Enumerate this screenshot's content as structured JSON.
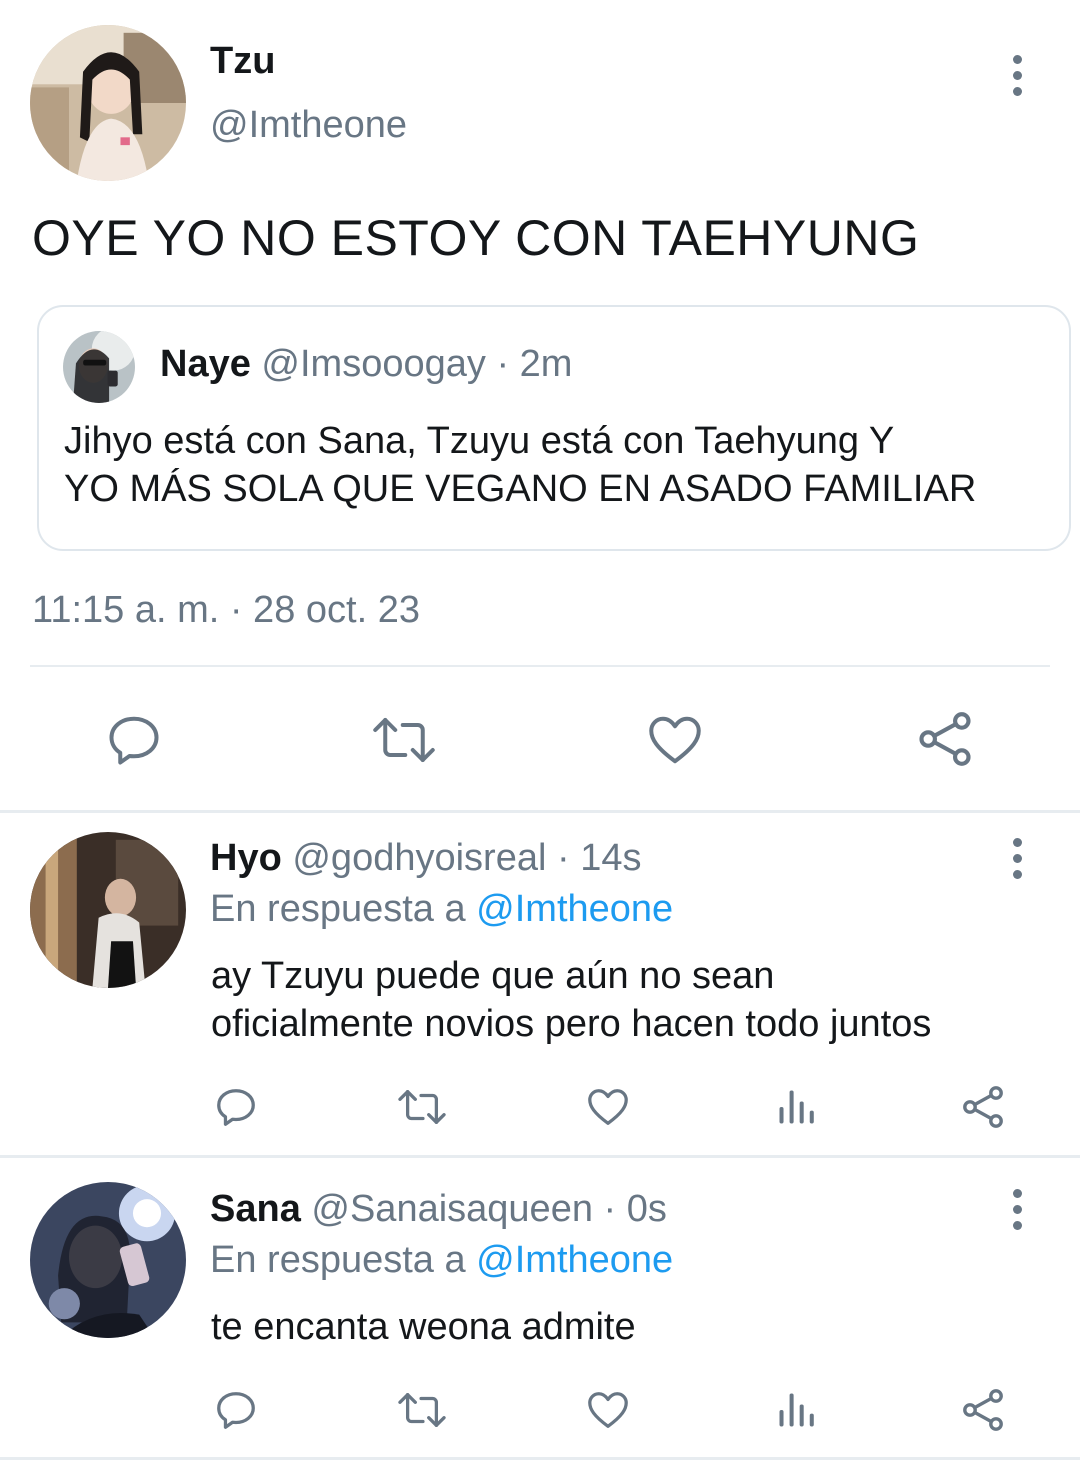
{
  "main_tweet": {
    "display_name": "Tzu",
    "handle": "@Imtheone",
    "text": "OYE YO NO ESTOY CON TAEHYUNG",
    "timestamp": "11:15 a. m. · 28 oct. 23",
    "quoted": {
      "display_name": "Naye",
      "handle": "@Imsooogay",
      "separator": "·",
      "time": "2m",
      "text_line1": "Jihyo está con Sana, Tzuyu está con Taehyung Y",
      "text_line2": "YO MÁS SOLA QUE VEGANO EN ASADO FAMILIAR"
    },
    "actions": [
      "reply-icon",
      "retweet-icon",
      "like-icon",
      "share-icon"
    ]
  },
  "replies": [
    {
      "display_name": "Hyo",
      "handle": "@godhyoisreal",
      "time": "· 14s",
      "reply_prefix": "En respuesta a",
      "reply_to": "@Imtheone",
      "text_line1": "ay Tzuyu puede que aún no sean",
      "text_line2": "oficialmente novios pero hacen todo juntos"
    },
    {
      "display_name": "Sana",
      "handle": "@Sanaisaqueen",
      "time": "· 0s",
      "reply_prefix": "En respuesta a",
      "reply_to": "@Imtheone",
      "text_line1": "te encanta weona admite"
    }
  ],
  "colors": {
    "text": "#14171a",
    "muted": "#687684",
    "link": "#1d9bf0",
    "divider": "#e7ecf0"
  }
}
